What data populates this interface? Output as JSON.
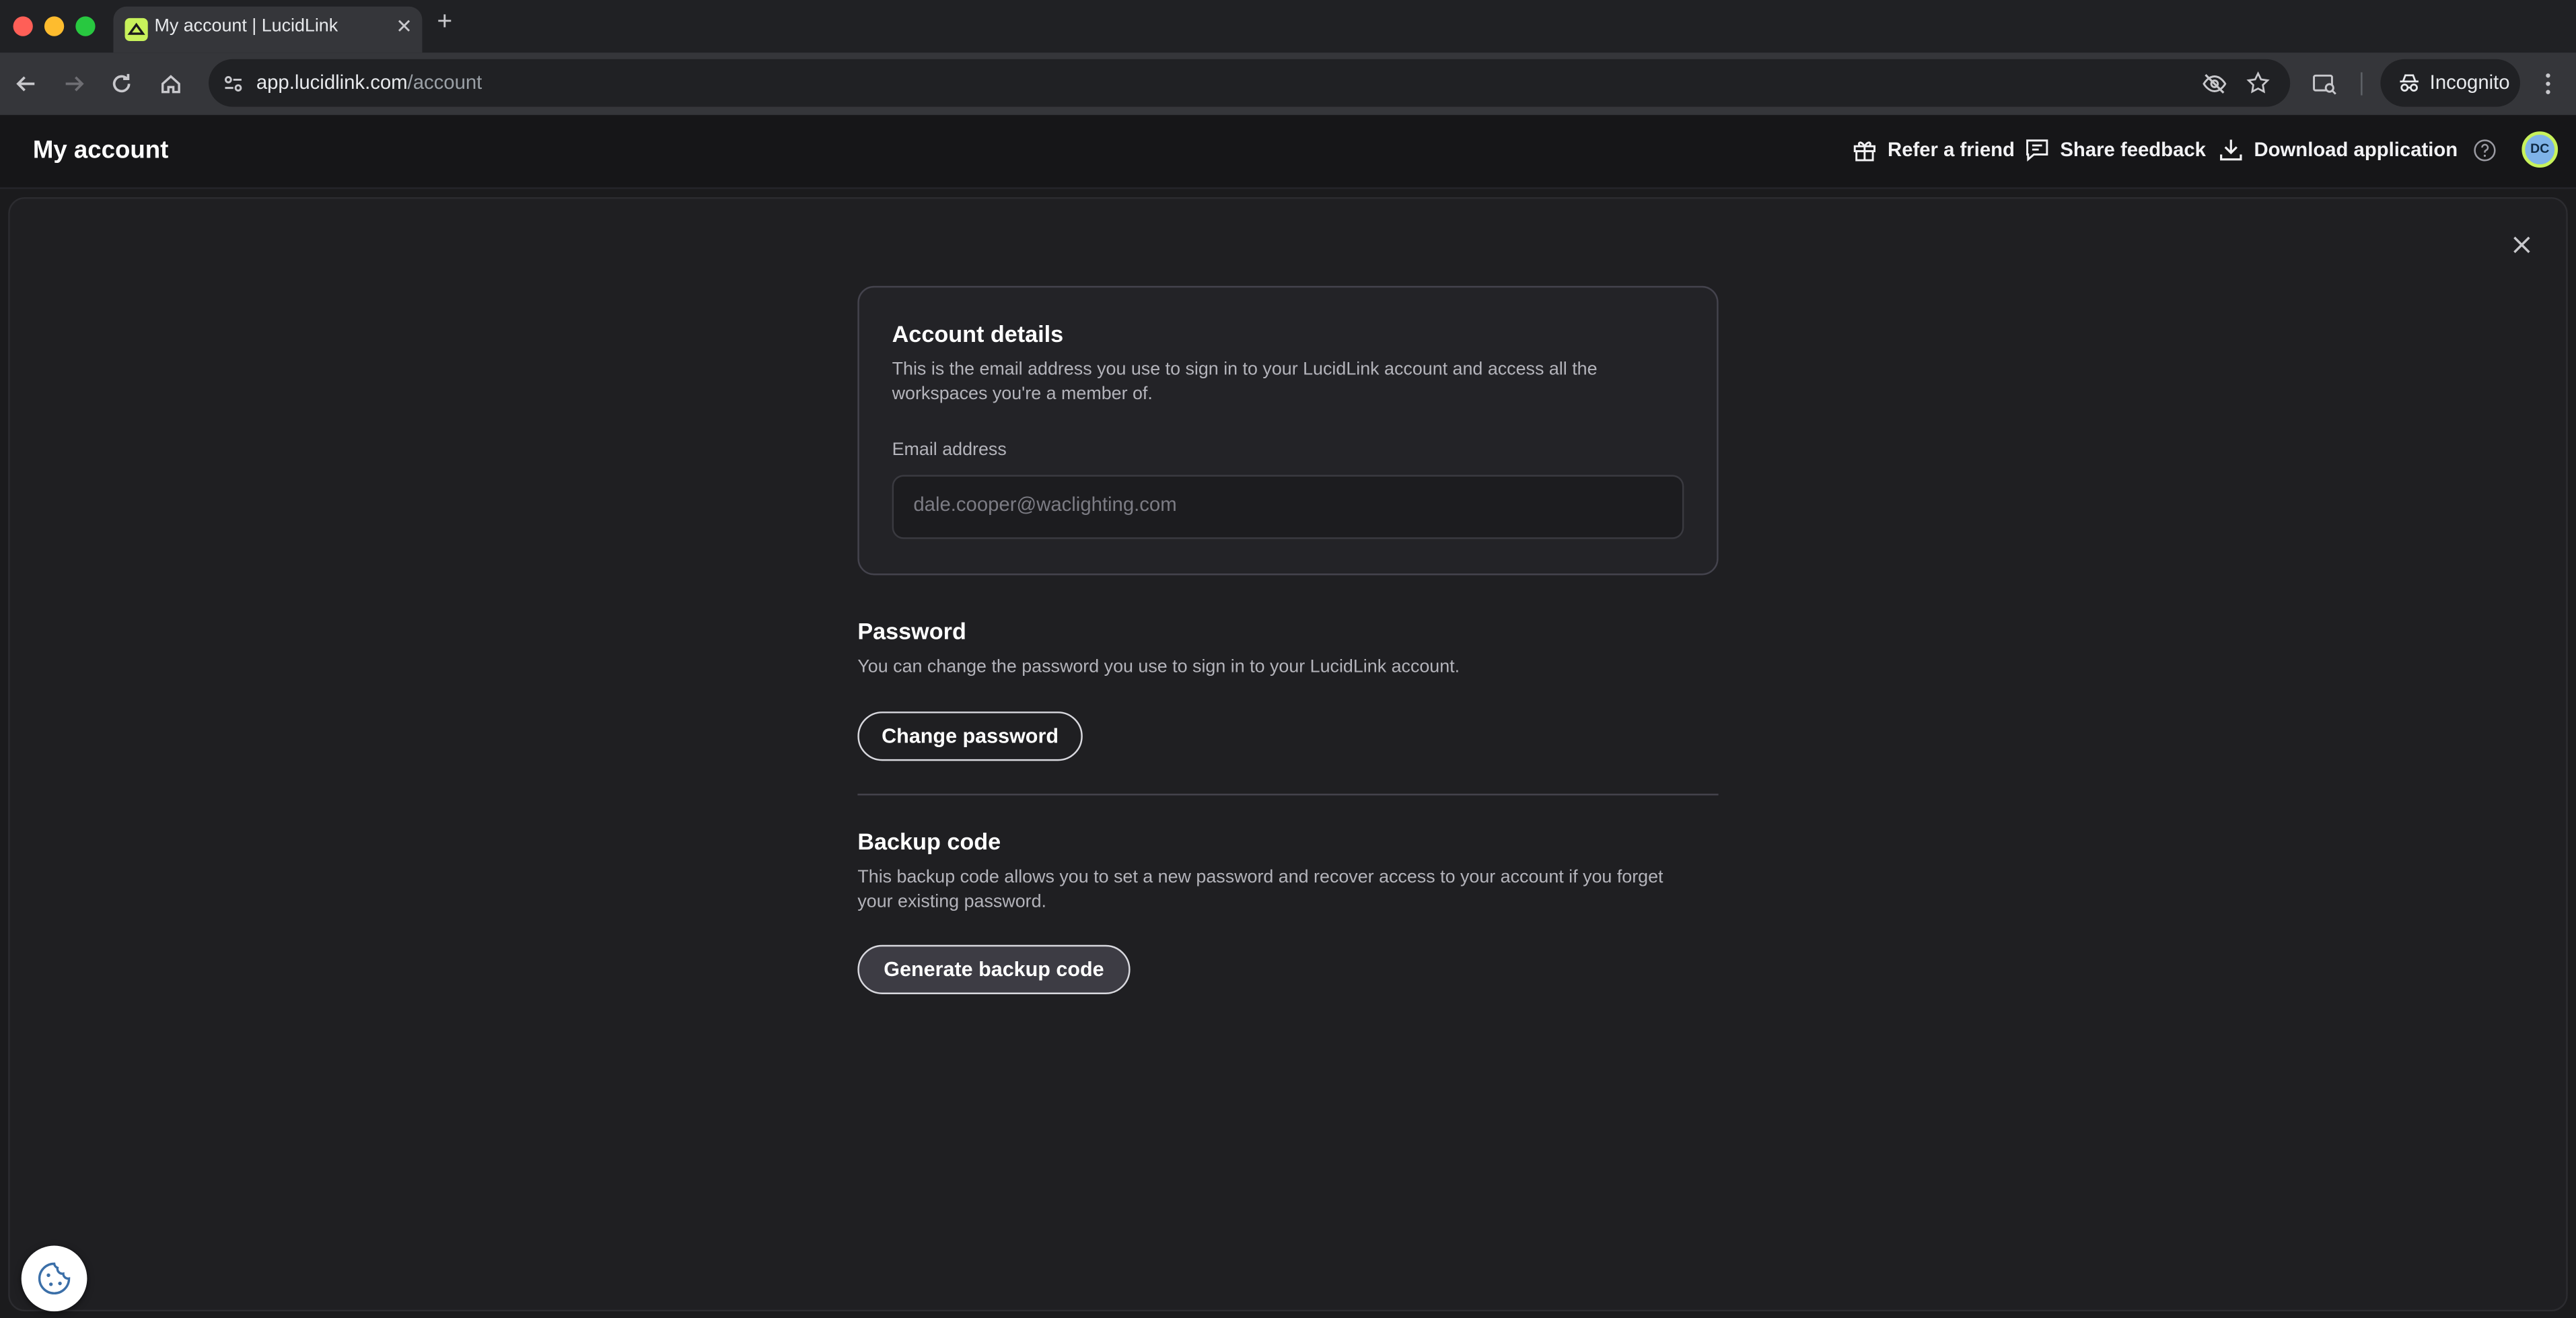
{
  "browser": {
    "tab_title": "My account | LucidLink",
    "url_host": "app.lucidlink.com",
    "url_path": "/account",
    "incognito_label": "Incognito"
  },
  "header": {
    "title": "My account",
    "actions": {
      "refer": "Refer a friend",
      "feedback": "Share feedback",
      "download": "Download application"
    },
    "avatar_initials": "DC"
  },
  "account": {
    "title": "Account details",
    "description": "This is the email address you use to sign in to your LucidLink account and access all the workspaces you're a member of.",
    "email_label": "Email address",
    "email_placeholder": "dale.cooper@waclighting.com"
  },
  "password": {
    "title": "Password",
    "description": "You can change the password you use to sign in to your LucidLink account.",
    "button": "Change password"
  },
  "backup": {
    "title": "Backup code",
    "description": "This backup code allows you to set a new password and recover access to your account if you forget your existing password.",
    "button": "Generate backup code"
  },
  "colors": {
    "background": "#1b1b1d",
    "panel": "#1f1f22",
    "accent": "#c8f25b",
    "avatar": "#7fb3e8"
  }
}
